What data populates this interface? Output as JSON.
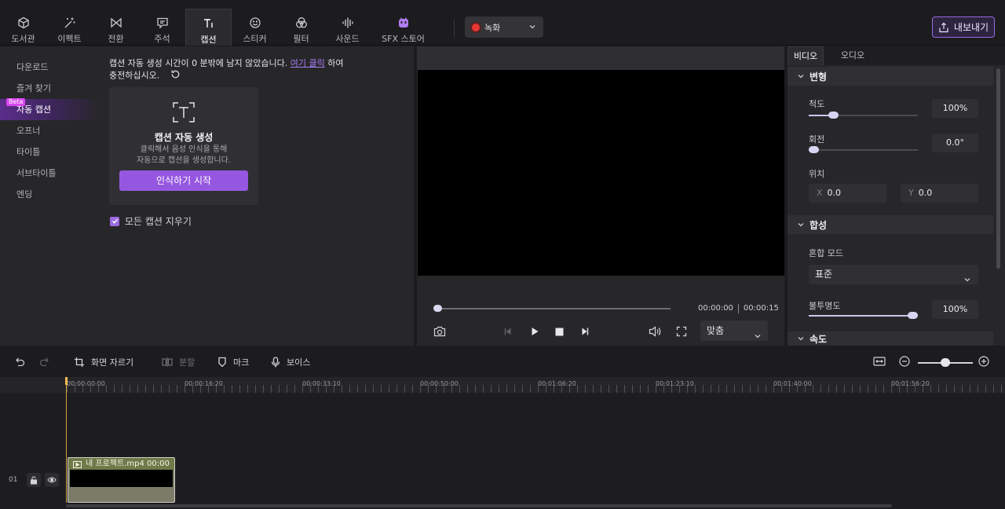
{
  "toolbar": {
    "tabs": [
      {
        "label": "도서관",
        "icon": "cube-icon"
      },
      {
        "label": "이펙트",
        "icon": "magic-wand-icon"
      },
      {
        "label": "전환",
        "icon": "transition-icon"
      },
      {
        "label": "주석",
        "icon": "comment-icon"
      },
      {
        "label": "캡션",
        "icon": "text-icon"
      },
      {
        "label": "스티커",
        "icon": "smiley-icon"
      },
      {
        "label": "필터",
        "icon": "filter-icon"
      },
      {
        "label": "사운드",
        "icon": "waveform-icon"
      },
      {
        "label": "SFX 스토어",
        "icon": "store-icon"
      }
    ],
    "active_tab": "캡션",
    "record_label": "녹화",
    "export_label": "내보내기",
    "accent": "#9657e0"
  },
  "sidebar": {
    "items": [
      "다운로드",
      "즐겨 찾기",
      "자동 캡션",
      "오프너",
      "타이틀",
      "서브타이틀",
      "엔딩"
    ],
    "active": "자동 캡션",
    "beta_badge": "Beta"
  },
  "captions": {
    "notice_pre": "캡션 자동 생성 시간이 0 분밖에 남지 않았습니다. ",
    "notice_link": "여기 클릭",
    "notice_post": " 하여",
    "notice_line2": "충전하십시오.",
    "card_title": "캡션 자동 생성",
    "card_desc_1": "클릭해서 음성 인식을 통해",
    "card_desc_2": "자동으로 캡션을 생성합니다.",
    "start_button": "인식하기 시작",
    "clear_checkbox": "모든 캡션 지우기",
    "clear_checked": true
  },
  "preview": {
    "current_time": "00:00:00",
    "total_time": "00:00:15",
    "progress": 0,
    "fit_label": "맞춤"
  },
  "properties": {
    "tabs": [
      "비디오",
      "오디오"
    ],
    "active_tab": "비디오",
    "transform": {
      "title": "변형",
      "scale_label": "척도",
      "scale_value": "100%",
      "scale_slider": 0.2,
      "rotate_label": "회전",
      "rotate_value": "0.0°",
      "rotate_slider": 0,
      "position_label": "위치",
      "x_axis": "X",
      "x_value": "0.0",
      "y_axis": "Y",
      "y_value": "0.0"
    },
    "composite": {
      "title": "합성",
      "blend_label": "혼합 모드",
      "blend_value": "표준",
      "opacity_label": "불투명도",
      "opacity_value": "100%",
      "opacity_slider": 1
    },
    "speed_title": "속도"
  },
  "timeline": {
    "tools": {
      "crop_label": "화면 자르기",
      "split_label": "분할",
      "mark_label": "마크",
      "voice_label": "보이스"
    },
    "ruler_labels": [
      "00:00:00:00",
      "00:00:16:20",
      "00:00:33:10",
      "00:00:50:00",
      "00:01:06:20",
      "00:01:23:10",
      "00:01:40:00",
      "00:01:56:20"
    ],
    "zoom_level": 0.5,
    "track_number": "01",
    "clip_title": "내 프로젝트.mp4",
    "clip_time": "00:00"
  }
}
